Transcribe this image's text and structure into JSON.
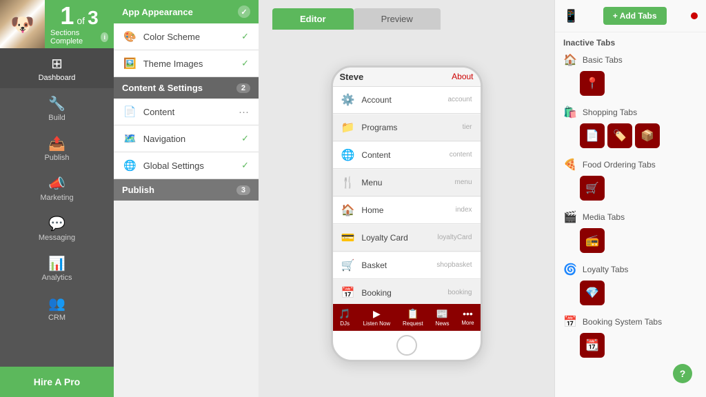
{
  "sidebar": {
    "sections_number": "1",
    "sections_of": "of",
    "sections_total": "3",
    "sections_complete": "Sections Complete",
    "nav_items": [
      {
        "id": "dashboard",
        "label": "Dashboard",
        "icon": "⊞"
      },
      {
        "id": "build",
        "label": "Build",
        "icon": "🔧"
      },
      {
        "id": "publish",
        "label": "Publish",
        "icon": "📤"
      },
      {
        "id": "marketing",
        "label": "Marketing",
        "icon": "📣"
      },
      {
        "id": "messaging",
        "label": "Messaging",
        "icon": "💬"
      },
      {
        "id": "analytics",
        "label": "Analytics",
        "icon": "📊"
      },
      {
        "id": "crm",
        "label": "CRM",
        "icon": "👥"
      }
    ],
    "hire_pro": "Hire A Pro"
  },
  "middle": {
    "app_appearance": "App Appearance",
    "color_scheme": "Color Scheme",
    "theme_images": "Theme Images",
    "content_settings": "Content & Settings",
    "content_settings_badge": "2",
    "content": "Content",
    "navigation": "Navigation",
    "global_settings": "Global Settings",
    "publish": "Publish",
    "publish_badge": "3"
  },
  "editor": {
    "editor_tab": "Editor",
    "preview_tab": "Preview"
  },
  "phone": {
    "name": "Steve",
    "about": "About",
    "menu_items": [
      {
        "icon": "⚙️",
        "label": "Account",
        "value": "account"
      },
      {
        "icon": "📁",
        "label": "Programs",
        "value": "tier"
      },
      {
        "icon": "🌐",
        "label": "Content",
        "value": "content"
      },
      {
        "icon": "🍴",
        "label": "Menu",
        "value": "menu"
      },
      {
        "icon": "🏠",
        "label": "Home",
        "value": "index"
      },
      {
        "icon": "💳",
        "label": "Loyalty Card",
        "value": "loyaltyCard"
      },
      {
        "icon": "🛒",
        "label": "Basket",
        "value": "shopbasket"
      },
      {
        "icon": "📅",
        "label": "Booking",
        "value": "booking"
      }
    ],
    "bottom_bar": [
      {
        "icon": "🎵",
        "label": "DJs"
      },
      {
        "icon": "▶",
        "label": "Listen Now"
      },
      {
        "icon": "📋",
        "label": "Request"
      },
      {
        "icon": "📰",
        "label": "News"
      },
      {
        "icon": "•••",
        "label": "More"
      }
    ]
  },
  "right_panel": {
    "add_tabs": "+ Add Tabs",
    "inactive_tabs": "Inactive Tabs",
    "tab_groups": [
      {
        "id": "basic",
        "label": "Basic Tabs",
        "icon": "🏠",
        "tabs": [
          {
            "icon": "📍"
          }
        ]
      },
      {
        "id": "shopping",
        "label": "Shopping Tabs",
        "icon": "🛍️",
        "tabs": [
          {
            "icon": "📄"
          },
          {
            "icon": "🏷️"
          },
          {
            "icon": "📦"
          }
        ]
      },
      {
        "id": "food",
        "label": "Food Ordering Tabs",
        "icon": "🍕",
        "tabs": [
          {
            "icon": "🛒"
          }
        ]
      },
      {
        "id": "media",
        "label": "Media Tabs",
        "icon": "🎬",
        "tabs": [
          {
            "icon": "📻"
          }
        ]
      },
      {
        "id": "loyalty",
        "label": "Loyalty Tabs",
        "icon": "🌀",
        "tabs": [
          {
            "icon": "💎"
          }
        ]
      },
      {
        "id": "booking",
        "label": "Booking System Tabs",
        "icon": "📅",
        "tabs": [
          {
            "icon": "📆"
          }
        ]
      }
    ],
    "help": "?"
  }
}
